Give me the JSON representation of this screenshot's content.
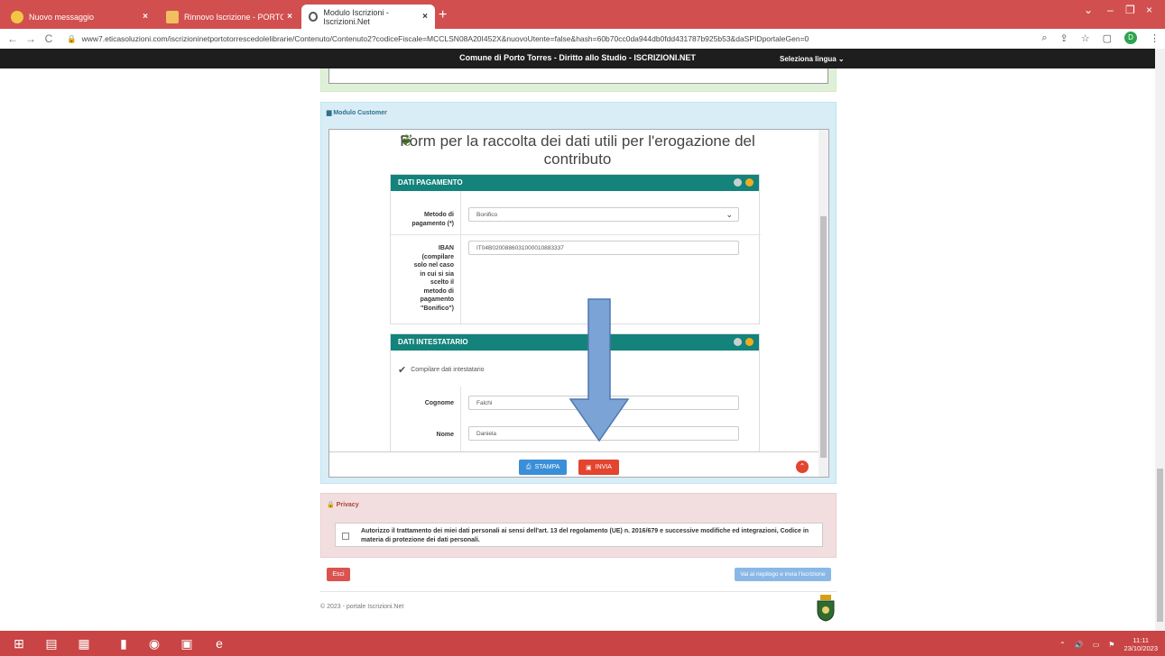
{
  "browser": {
    "tabs": [
      {
        "title": "Nuovo messaggio",
        "active": false
      },
      {
        "title": "Rinnovo Iscrizione - PORTO TORR",
        "active": false
      },
      {
        "title": "Modulo Iscrizioni - Iscrizioni.Net",
        "active": true
      }
    ],
    "url": "www7.eticasoluzioni.com/iscrizioninetportotorrescedolelibrarie/Contenuto/Contenuto2?codiceFiscale=MCCLSN08A20I452X&nuovoUtente=false&hash=60b70cc0da944db0fdd431787b925b53&daSPIDportaleGen=0",
    "profile_initial": "D"
  },
  "site": {
    "title": "Comune di Porto Torres - Diritto allo Studio - ISCRIZIONI.NET",
    "language_label": "Seleziona lingua"
  },
  "customer_panel": {
    "heading": "Modulo Customer",
    "form_title": "Form per la raccolta dei dati utili per l'erogazione del contributo"
  },
  "pagamento": {
    "heading": "DATI PAGAMENTO",
    "metodo_label": "Metodo di pagamento (*)",
    "metodo_value": "Bonifico",
    "iban_label": "IBAN (compilare solo nel caso in cui si sia scelto il metodo di pagamento \"Bonifico\")",
    "iban_value": "IT04B0200886031000010883337"
  },
  "intestatario": {
    "heading": "DATI INTESTATARIO",
    "checkbox_label": "Compilare dati intestatario",
    "cognome_label": "Cognome",
    "cognome_value": "Falchi",
    "nome_label": "Nome",
    "nome_value": "Daniela"
  },
  "actions": {
    "stampa_label": "STAMPA",
    "invia_label": "INVIA"
  },
  "privacy": {
    "heading": "Privacy",
    "text": "Autorizzo il trattamento dei miei dati personali ai sensi dell'art. 13 del regolamento (UE) n. 2016/679 e successive modifiche ed integrazioni, Codice in materia di protezione dei dati personali."
  },
  "bottom": {
    "esci_label": "Esci",
    "riepilogo_label": "Vai al riepilogo e invia l'iscrizione",
    "copyright": "© 2023 - portale Iscrizioni.Net"
  },
  "taskbar": {
    "time": "11:11",
    "date": "23/10/2023"
  },
  "colors": {
    "tab_bar": "#d24f4f",
    "section_header": "#13837b",
    "invia_button": "#e3452e",
    "stampa_button": "#3a8fd8",
    "arrow_fill": "#7ba3d6"
  }
}
